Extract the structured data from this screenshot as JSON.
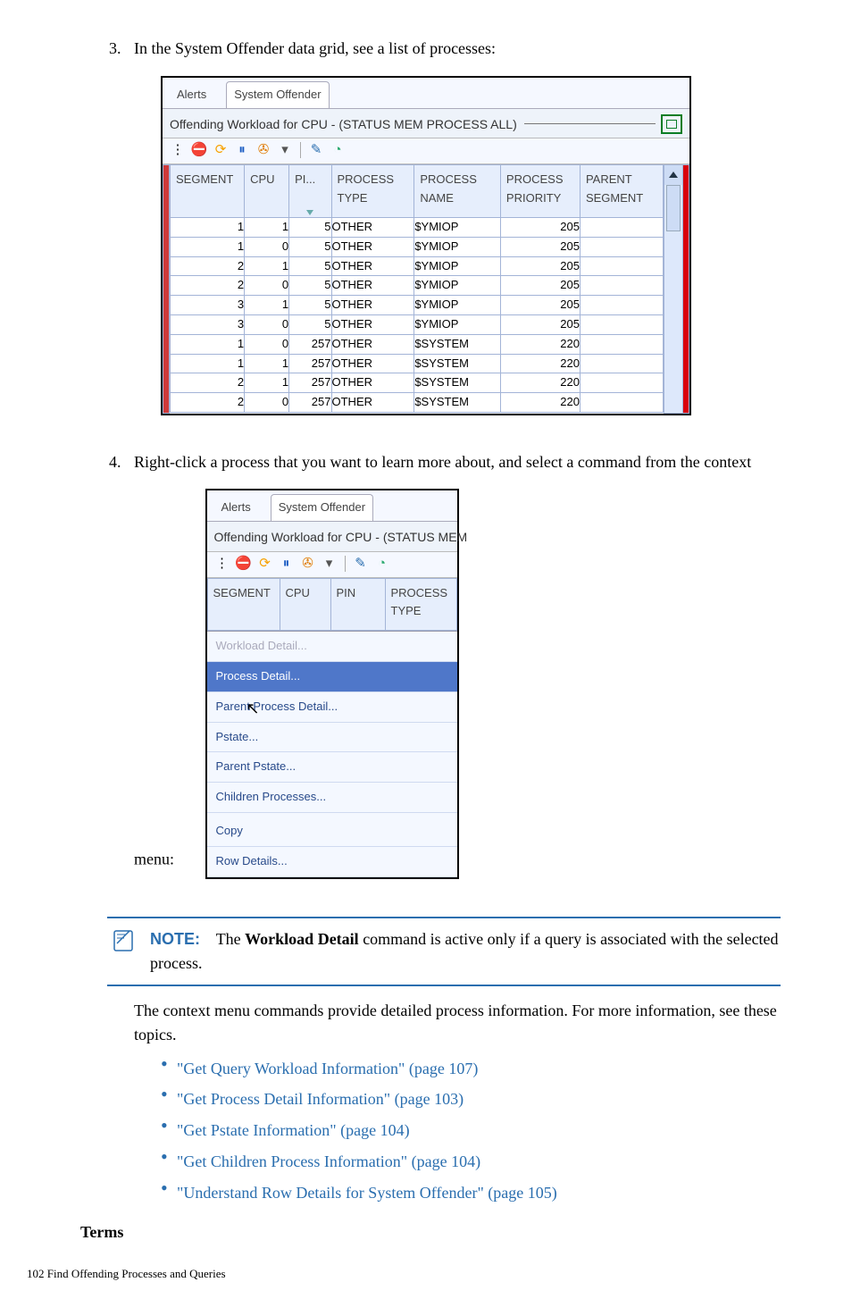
{
  "step3_text": "In the System Offender data grid, see a list of processes:",
  "step4_text": "Right-click a process that you want to learn more about, and select a command from the context menu:",
  "tabs": {
    "alerts": "Alerts",
    "offender": "System Offender"
  },
  "panel": {
    "title_full": "Offending Workload for CPU - (STATUS MEM PROCESS ALL)",
    "title_short": "Offending Workload for CPU - (STATUS MEM"
  },
  "grid": {
    "cols": {
      "segment": "SEGMENT",
      "cpu": "CPU",
      "pin": "PI...",
      "ptype": "PROCESS TYPE",
      "pname": "PROCESS NAME",
      "ppriority": "PROCESS PRIORITY",
      "psegment": "PARENT SEGMENT"
    },
    "cols2": {
      "segment": "SEGMENT",
      "cpu": "CPU",
      "pin": "PIN",
      "ptype": "PROCESS TYPE"
    },
    "rows": [
      {
        "segment": "1",
        "cpu": "1",
        "pin": "5",
        "ptype": "OTHER",
        "pname": "$YMIOP",
        "ppriority": "205",
        "psegment": ""
      },
      {
        "segment": "1",
        "cpu": "0",
        "pin": "5",
        "ptype": "OTHER",
        "pname": "$YMIOP",
        "ppriority": "205",
        "psegment": ""
      },
      {
        "segment": "2",
        "cpu": "1",
        "pin": "5",
        "ptype": "OTHER",
        "pname": "$YMIOP",
        "ppriority": "205",
        "psegment": ""
      },
      {
        "segment": "2",
        "cpu": "0",
        "pin": "5",
        "ptype": "OTHER",
        "pname": "$YMIOP",
        "ppriority": "205",
        "psegment": ""
      },
      {
        "segment": "3",
        "cpu": "1",
        "pin": "5",
        "ptype": "OTHER",
        "pname": "$YMIOP",
        "ppriority": "205",
        "psegment": ""
      },
      {
        "segment": "3",
        "cpu": "0",
        "pin": "5",
        "ptype": "OTHER",
        "pname": "$YMIOP",
        "ppriority": "205",
        "psegment": ""
      },
      {
        "segment": "1",
        "cpu": "0",
        "pin": "257",
        "ptype": "OTHER",
        "pname": "$SYSTEM",
        "ppriority": "220",
        "psegment": ""
      },
      {
        "segment": "1",
        "cpu": "1",
        "pin": "257",
        "ptype": "OTHER",
        "pname": "$SYSTEM",
        "ppriority": "220",
        "psegment": ""
      },
      {
        "segment": "2",
        "cpu": "1",
        "pin": "257",
        "ptype": "OTHER",
        "pname": "$SYSTEM",
        "ppriority": "220",
        "psegment": ""
      },
      {
        "segment": "2",
        "cpu": "0",
        "pin": "257",
        "ptype": "OTHER",
        "pname": "$SYSTEM",
        "ppriority": "220",
        "psegment": ""
      }
    ]
  },
  "context_menu": {
    "items": [
      {
        "label": "Workload Detail...",
        "state": "disabled"
      },
      {
        "label": "Process Detail...",
        "state": "selected"
      },
      {
        "label": "Parent Process Detail...",
        "state": "normal"
      },
      {
        "label": "Pstate...",
        "state": "normal"
      },
      {
        "label": "Parent Pstate...",
        "state": "normal"
      },
      {
        "label": "Children Processes...",
        "state": "normal"
      },
      {
        "label": "__sep__"
      },
      {
        "label": "Copy",
        "state": "normal"
      },
      {
        "label": "Row Details...",
        "state": "normal"
      }
    ]
  },
  "note": {
    "label": "NOTE:",
    "text_before": "The ",
    "bold": "Workload Detail",
    "text_after": " command is active only if a query is associated with the selected process."
  },
  "after_note": "The context menu commands provide detailed process information. For more information, see these topics.",
  "links": [
    "\"Get Query Workload Information\" (page 107)",
    "\"Get Process Detail Information\" (page 103)",
    "\"Get Pstate Information\" (page 104)",
    "\"Get Children Process Information\" (page 104)",
    "\"Understand Row Details for System Offender\" (page 105)"
  ],
  "terms_heading": "Terms",
  "footer": "102   Find Offending Processes and Queries"
}
